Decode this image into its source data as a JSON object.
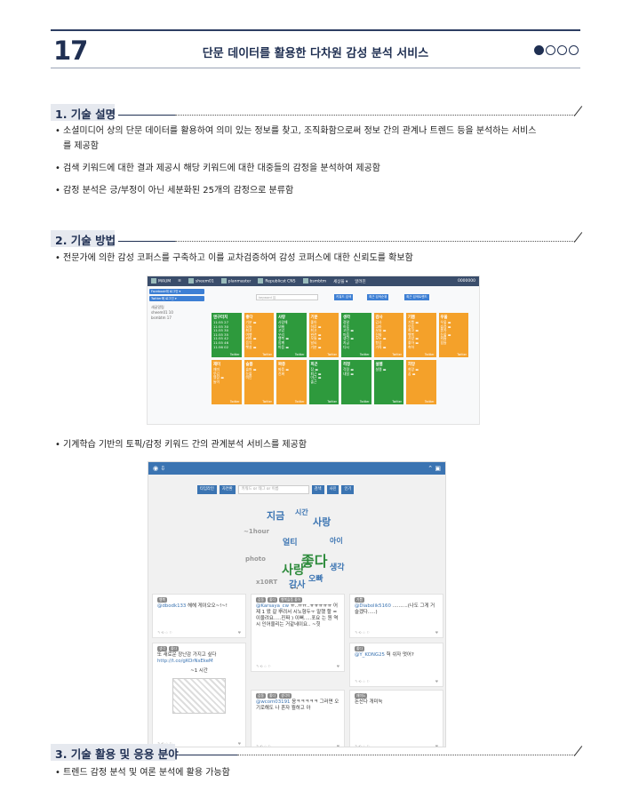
{
  "header": {
    "page_number": "17",
    "title": "단문 데이터를 활용한 다차원 감성 분석 서비스",
    "dots": [
      true,
      false,
      false,
      false
    ]
  },
  "sections": [
    {
      "title": "1. 기술 설명",
      "bullets": [
        [
          "소셜미디어 상의 단문 데이터를 활용하여 의미 있는 정보를 찾고, 조직화함으로써 정보 간의 관계나 트렌드 등을 분석하는 서비스",
          "를 제공함"
        ],
        [
          "검색 키워드에 대한 결과 제공시 해당 키워드에 대한 대중들의 감정을 분석하여 제공함"
        ],
        [
          "감정 분석은 긍/부정이 아닌 세분화된 25개의 감정으로 분류함"
        ]
      ]
    },
    {
      "title": "2. 기술 방법",
      "bullets": [
        [
          "전문가에 의한 감성 코퍼스를 구축하고 이를 교차검증하여 감성 코퍼스에 대한 신뢰도를 확보함"
        ],
        [
          "기계학습 기반의 토픽/감정 키워드 간의 관계분석 서비스를 제공함"
        ]
      ]
    },
    {
      "title": "3. 기술 활용 및 응용 분야",
      "bullets": [
        [
          "트렌드 감정 분석 및 여론 분석에 활용 가능함"
        ]
      ]
    }
  ],
  "shot1": {
    "nav": [
      "MAUM",
      "≡",
      "sheem01",
      "planmaster",
      "Republicst CNS",
      "bsmbtm",
      "세상을 ▾",
      "알려진"
    ],
    "nav_right": "0000000",
    "side_buttons": [
      "Facebook에 로그인 ▾",
      "Twitter에 로그인 ▾"
    ],
    "side_text": [
      "새글알림",
      "sheem01 10",
      "bsmbtm 17"
    ],
    "search_placeholder": "keyword 입",
    "search_buttons": [
      "키워드 검색",
      "최근 검색순위",
      "최근 검색트렌드"
    ],
    "tiles": [
      {
        "c": "g",
        "head": "엔구터치",
        "lines": [
          "11:55 27",
          "11:55 30",
          "11:55 30",
          "11:55 35",
          "11:55 42",
          "11:55 46",
          "11:56 02"
        ]
      },
      {
        "c": "o",
        "head": "좋다",
        "lines": [
          "기분 ▬",
          "오늘",
          "최고",
          "여행",
          "커피 ▬",
          "음악",
          "햇살 ▬"
        ]
      },
      {
        "c": "g",
        "head": "사랑",
        "lines": [
          "사랑해",
          "오빠",
          "고맙",
          "우리",
          "행복 ▬",
          "함께",
          "마음 ▬"
        ]
      },
      {
        "c": "o",
        "head": "기분",
        "lines": [
          "좋아",
          "하루 ▬",
          "최고",
          "완전 ▬",
          "오늘 ▬",
          "날씨",
          "기분 ▬"
        ]
      },
      {
        "c": "g",
        "head": "생각",
        "lines": [
          "정말",
          "하루",
          "고민 ▬",
          "마음",
          "생각 ▬",
          "지금",
          "다시"
        ]
      },
      {
        "c": "o",
        "head": "감사",
        "lines": [
          "감사",
          "고마",
          "오늘 ▬",
          "진짜",
          "모두 ▬",
          "항상",
          "가족 ▬"
        ]
      },
      {
        "c": "o",
        "head": "기쁨",
        "lines": [
          "기쁨 ▬",
          "웃음",
          "최고 ▬",
          "행복",
          "사랑 ▬",
          "좋아 ▬",
          "축하"
        ]
      },
      {
        "c": "o",
        "head": "우울",
        "lines": [
          "우울 ▬",
          "슬픔 ▬",
          "혼자",
          "눈물 ▬",
          "외롭",
          "힘들"
        ]
      },
      {
        "c": "o",
        "head": "재미",
        "lines": [
          "재미",
          "웃김",
          "영상 ▬",
          "놀이"
        ]
      },
      {
        "c": "o",
        "head": "슬픔",
        "lines": [
          "슬퍼 ▬",
          "눈물",
          "미안"
        ]
      },
      {
        "c": "o",
        "head": "짜증",
        "lines": [
          "짜증 ▬",
          "진짜"
        ]
      },
      {
        "c": "g",
        "head": "피곤",
        "lines": [
          "잠 ▬",
          "퇴근 ▬",
          "야근 ▬",
          "출근"
        ]
      },
      {
        "c": "g",
        "head": "걱정",
        "lines": [
          "걱정 ▬",
          "내일 ▬"
        ]
      },
      {
        "c": "g",
        "head": "설렘",
        "lines": [
          "설렘 ▬"
        ]
      },
      {
        "c": "o",
        "head": "희망",
        "lines": [
          "희망 ▬",
          "꿈 ▬"
        ]
      }
    ],
    "tile_footer": "Twitter"
  },
  "shot2": {
    "toolbar": [
      "타임라인",
      "자연환",
      "검색",
      "사진",
      "인기"
    ],
    "input_placeholder": "키워드 or 태그 or 이름",
    "words": [
      {
        "t": "지금",
        "c": "#3b74b2"
      },
      {
        "t": "시간",
        "c": "#3b74b2"
      },
      {
        "t": "사랑",
        "c": "#3b74b2"
      },
      {
        "t": "~1hour",
        "c": "#999999"
      },
      {
        "t": "얼티",
        "c": "#3b74b2"
      },
      {
        "t": "아이",
        "c": "#3b74b2"
      },
      {
        "t": "좋다",
        "c": "#2e8b3c"
      },
      {
        "t": "photo",
        "c": "#999999"
      },
      {
        "t": "사랑",
        "c": "#2e8b3c"
      },
      {
        "t": "생각",
        "c": "#3b74b2"
      },
      {
        "t": "오빠",
        "c": "#3b74b2"
      },
      {
        "t": "x10RT",
        "c": "#999999"
      },
      {
        "t": "감사",
        "c": "#3b74b2"
      }
    ],
    "pager": "• •",
    "cards": [
      {
        "tags": [
          "행복"
        ],
        "user": "@dbodk133",
        "text": "헤헤 게이오오~!~!"
      },
      {
        "tags": [
          "감동",
          "좋다",
          "행복슬픔 좋아"
        ],
        "user": "@Karsaya_cw",
        "text": "ㅠ..ㅠㅠ..ㅠㅠㅠㅠㅠ 어제 1 왔 갈 뿌려서 시노형두ㅜ 말했 할 = 이울려요.....진짜 ) 이뻐.....포요 는 원 역시 인어울리는 거같네이요.. ~힛"
      },
      {
        "tags": [
          "기쁨"
        ],
        "user": "@Diabolik5160",
        "text": "..........(나도 그게 거 슬겠다.....)"
      },
      {
        "tags": [
          "생각",
          "좋다"
        ],
        "user": "",
        "text": "또 새로운 장난감 가지고 싶다",
        "link": "http://t.co/gKOrNsEkeM",
        "extra": "~1 시간"
      },
      {
        "tags": [
          "좋다"
        ],
        "user": "@Y_KONG25",
        "text": "헉 쉬자 멋어?"
      },
      {
        "tags": [
          "감동",
          "좋다",
          "생각이"
        ],
        "user": "@wcom03191",
        "text": "응ㅋㅋㅋㅋㅋ 그러면 오기로해도 나 혼자 뭘하고 아"
      },
      {
        "tags": [
          "재미도"
        ],
        "user": "",
        "text": "돈산다 개미눅"
      }
    ]
  }
}
